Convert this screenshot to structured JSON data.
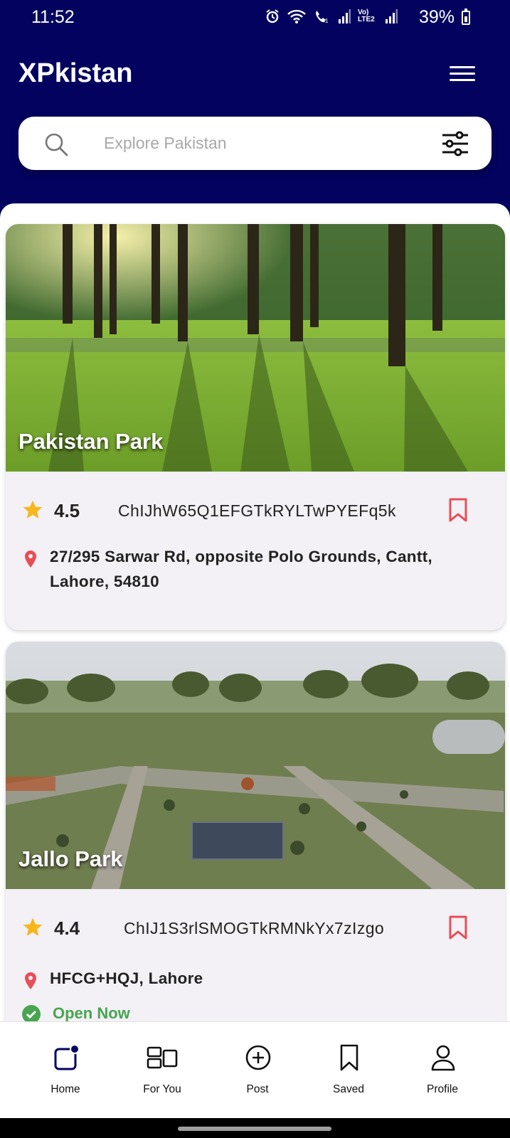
{
  "status_bar": {
    "time": "11:52",
    "battery": "39%",
    "network_label": "Vo) LTE2"
  },
  "app": {
    "title": "XPkistan",
    "header_color": "#03035f"
  },
  "search": {
    "placeholder": "Explore Pakistan",
    "value": ""
  },
  "places": [
    {
      "name": "Pakistan Park",
      "rating": "4.5",
      "place_id": "ChIJhW65Q1EFGTkRYLTwPYEFq5k",
      "address": "27/295 Sarwar Rd, opposite Polo Grounds, Cantt, Lahore, 54810",
      "image_type": "park-trees-grass"
    },
    {
      "name": "Jallo Park",
      "rating": "4.4",
      "place_id": "ChIJ1S3rlSMOGTkRMNkYx7zIzgo",
      "address": "HFCG+HQJ, Lahore",
      "status": "Open Now",
      "image_type": "park-aerial-view"
    }
  ],
  "bottom_nav": {
    "items": [
      {
        "label": "Home",
        "icon": "home-icon",
        "active": true
      },
      {
        "label": "For You",
        "icon": "for-you-icon"
      },
      {
        "label": "Post",
        "icon": "post-icon"
      },
      {
        "label": "Saved",
        "icon": "saved-icon"
      },
      {
        "label": "Profile",
        "icon": "profile-icon"
      }
    ]
  },
  "colors": {
    "accent_dark_blue": "#03035f",
    "bookmark_red": "#e84e55",
    "star_yellow": "#f6b71b",
    "open_green": "#47a64f",
    "card_background": "#f3f0f6"
  }
}
